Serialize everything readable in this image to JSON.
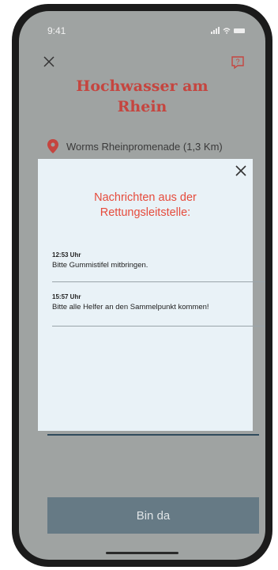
{
  "status_bar": {
    "time": "9:41"
  },
  "header": {
    "title_line1": "Hochwasser am",
    "title_line2": "Rhein"
  },
  "location": {
    "text": "Worms Rheinpromenade (1,3 Km)"
  },
  "modal": {
    "title_line1": "Nachrichten aus der",
    "title_line2": "Rettungsleitstelle:",
    "messages": [
      {
        "time": "12:53 Uhr",
        "text": "Bitte Gummistifel mitbringen."
      },
      {
        "time": "15:57 Uhr",
        "text": "Bitte alle Helfer an den Sammelpunkt kommen!"
      }
    ]
  },
  "action_button": {
    "label": "Bin da"
  },
  "colors": {
    "accent": "#e64b3c",
    "title": "#c5453f",
    "button": "#667a85",
    "modal_bg": "#e9f2f7"
  }
}
